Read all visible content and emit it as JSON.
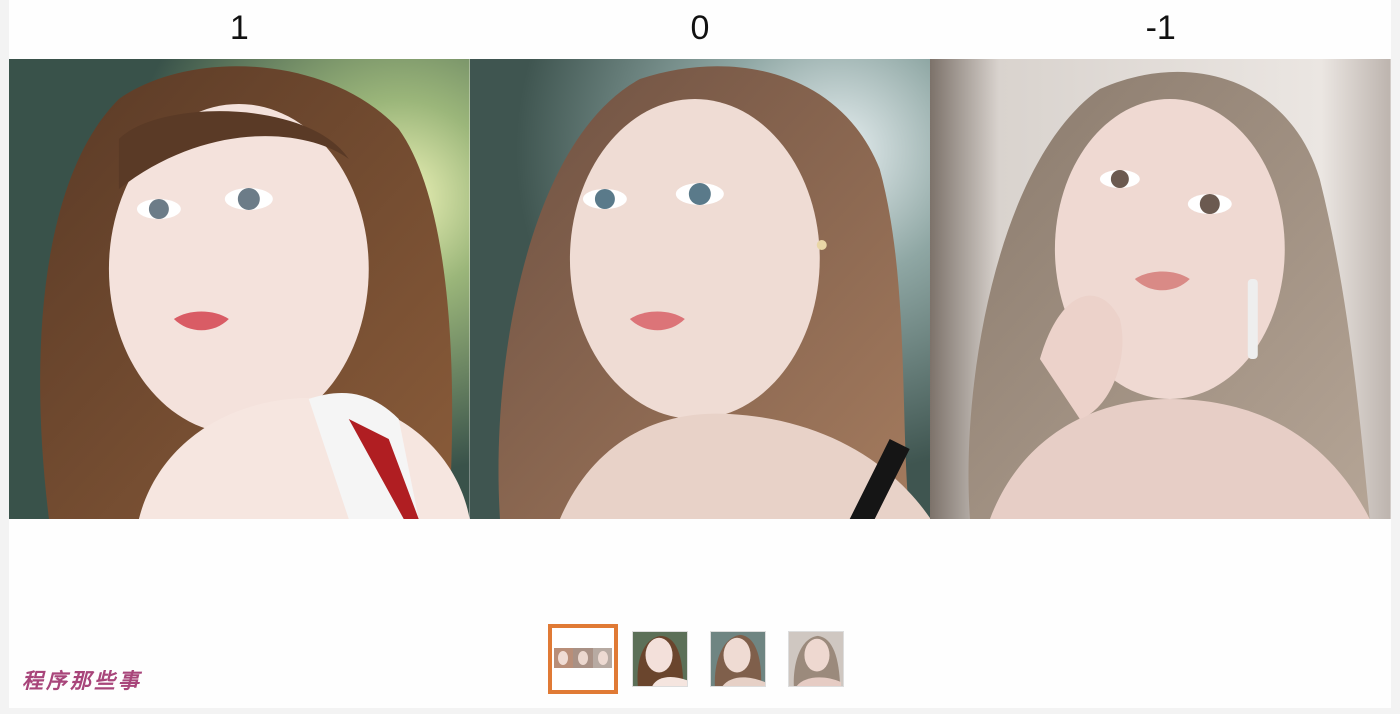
{
  "viewer": {
    "panels": [
      {
        "label": "1"
      },
      {
        "label": "0"
      },
      {
        "label": "-1"
      }
    ],
    "thumbnails": [
      {
        "selected": true,
        "content": "composite-strip"
      },
      {
        "selected": false,
        "content": "portrait-1"
      },
      {
        "selected": false,
        "content": "portrait-2"
      },
      {
        "selected": false,
        "content": "portrait-3"
      }
    ]
  },
  "watermark": {
    "text": "程序那些事"
  },
  "colors": {
    "selection_border": "#e07a35",
    "watermark": "#a8457a",
    "background": "#fefefe"
  }
}
